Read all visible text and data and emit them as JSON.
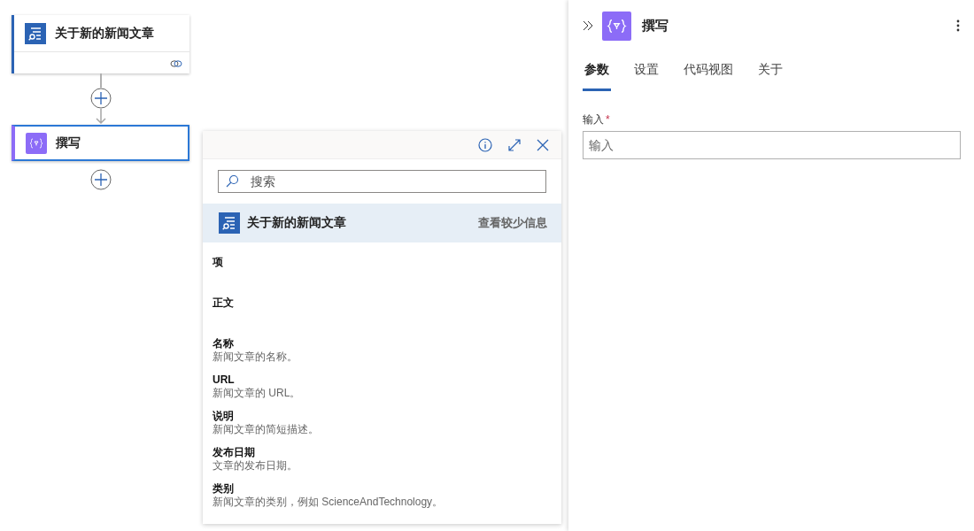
{
  "canvas": {
    "nodes": [
      {
        "kind": "trigger",
        "title": "关于新的新闻文章",
        "selected": false
      },
      {
        "kind": "action",
        "title": "撰写",
        "selected": true
      }
    ]
  },
  "picker": {
    "search": {
      "placeholder": "搜索"
    },
    "source": {
      "title": "关于新的新闻文章",
      "toggle": "查看较少信息"
    },
    "items": [
      {
        "name": "项"
      },
      {
        "name": "正文"
      },
      {
        "name": "名称",
        "description": "新闻文章的名称。"
      },
      {
        "name": "URL",
        "description": "新闻文章的 URL。"
      },
      {
        "name": "说明",
        "description": "新闻文章的简短描述。"
      },
      {
        "name": "发布日期",
        "description": "文章的发布日期。"
      },
      {
        "name": "类别",
        "description": "新闻文章的类别，例如 ScienceAndTechnology。"
      }
    ]
  },
  "panel": {
    "title": "撰写",
    "tabs": [
      {
        "label": "参数",
        "selected": true
      },
      {
        "label": "设置",
        "selected": false
      },
      {
        "label": "代码视图",
        "selected": false
      },
      {
        "label": "关于",
        "selected": false
      }
    ],
    "field": {
      "label": "输入",
      "required_mark": "*",
      "placeholder": "输入"
    }
  }
}
